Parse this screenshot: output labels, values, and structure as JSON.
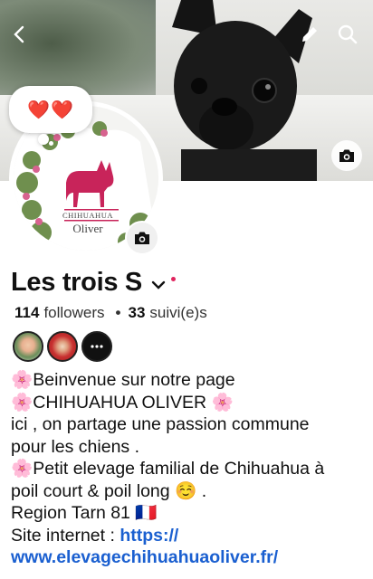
{
  "profile": {
    "name": "Les trois S",
    "followers_count": "114",
    "followers_label": "followers",
    "following_count": "33",
    "following_label": "suivi(e)s",
    "status_emoji": "❤️❤️"
  },
  "avatar_logo": {
    "line1": "CHIHUAHUA",
    "line2": "Oliver"
  },
  "bio": {
    "line1": "🌸Beinvenue sur notre page",
    "line2": "🌸CHIHUAHUA OLIVER 🌸",
    "line3": "ici , on partage une passion commune",
    "line4": "pour les chiens .",
    "line5": "🌸Petit elevage familial de Chihuahua à",
    "line6": "poil court & poil long ☺️ .",
    "line7": "Region Tarn 81 🇫🇷",
    "line8_label": "Site internet : ",
    "line8_link": "https://",
    "line9_link": "www.elevagechihuahuaoliver.fr/"
  },
  "icons": {
    "back": "back-chevron-icon",
    "edit": "pencil-icon",
    "search": "search-icon",
    "camera": "camera-icon",
    "dropdown": "chevron-down-icon",
    "more": "ellipsis-icon"
  },
  "colors": {
    "link": "#1a5fd0",
    "logo": "#c8245a",
    "notification_dot": "#e0245e"
  }
}
